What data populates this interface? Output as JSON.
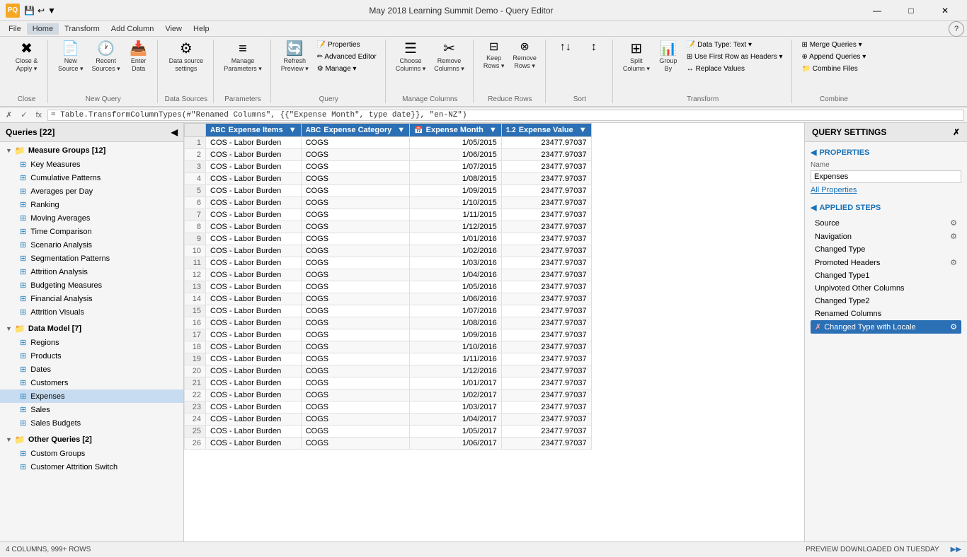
{
  "titleBar": {
    "appIcon": "PQ",
    "title": "May 2018 Learning Summit Demo - Query Editor",
    "quickActions": [
      "💾",
      "↩",
      "▼"
    ]
  },
  "menuBar": {
    "items": [
      "File",
      "Home",
      "Transform",
      "Add Column",
      "View",
      "Help"
    ]
  },
  "ribbonTabs": {
    "activeTab": "Home",
    "tabs": [
      "File",
      "Home",
      "Transform",
      "Add Column",
      "View",
      "Help"
    ]
  },
  "ribbonGroups": {
    "close": {
      "label": "Close",
      "buttons": [
        {
          "icon": "✖",
          "label": "Close &\nApply ▾"
        }
      ]
    },
    "newQuery": {
      "label": "New Query",
      "buttons": [
        {
          "icon": "📄",
          "label": "New\nSource ▾"
        },
        {
          "icon": "🕐",
          "label": "Recent\nSources ▾"
        },
        {
          "icon": "📥",
          "label": "Enter\nData"
        }
      ]
    },
    "dataSources": {
      "label": "Data Sources",
      "buttons": [
        {
          "icon": "⚙",
          "label": "Data source\nsettings"
        }
      ]
    },
    "parameters": {
      "label": "Parameters",
      "buttons": [
        {
          "icon": "≡",
          "label": "Manage\nParameters ▾"
        }
      ]
    },
    "query": {
      "label": "Query",
      "buttons": [
        {
          "icon": "🔄",
          "label": "Refresh\nPreview ▾"
        },
        {
          "icon": "📝",
          "label": "Properties"
        },
        {
          "icon": "✏",
          "label": "Advanced Editor"
        },
        {
          "icon": "⚙",
          "label": "Manage ▾"
        }
      ]
    },
    "manageColumns": {
      "label": "Manage Columns",
      "buttons": [
        {
          "icon": "☰",
          "label": "Choose\nColumns ▾"
        },
        {
          "icon": "✂",
          "label": "Remove\nColumns ▾"
        }
      ]
    },
    "reduceRows": {
      "label": "Reduce Rows",
      "buttons": [
        {
          "icon": "⊟",
          "label": "Keep\nRows ▾"
        },
        {
          "icon": "⊗",
          "label": "Remove\nRows ▾"
        }
      ]
    },
    "sort": {
      "label": "Sort",
      "buttons": [
        {
          "icon": "↑↓",
          "label": ""
        },
        {
          "icon": "↕",
          "label": ""
        }
      ]
    },
    "transform": {
      "label": "Transform",
      "smallButtons": [
        "Data Type: Text ▾",
        "Use First Row as Headers ▾",
        "Replace Values"
      ],
      "buttons": [
        {
          "icon": "⊞",
          "label": "Split\nColumn ▾"
        },
        {
          "icon": "📊",
          "label": "Group\nBy"
        }
      ]
    },
    "combine": {
      "label": "Combine",
      "smallButtons": [
        "Merge Queries ▾",
        "Append Queries ▾",
        "Combine Files"
      ]
    }
  },
  "formulaBar": {
    "checkmark": "✓",
    "cross": "✗",
    "fx": "fx",
    "formula": "= Table.TransformColumnTypes(#\"Renamed Columns\", {{\"Expense Month\", type date}}, \"en-NZ\")"
  },
  "sidebar": {
    "title": "Queries [22]",
    "groups": [
      {
        "name": "Measure Groups [12]",
        "expanded": true,
        "items": [
          "Key Measures",
          "Cumulative Patterns",
          "Averages per Day",
          "Ranking",
          "Moving Averages",
          "Time Comparison",
          "Scenario Analysis",
          "Segmentation Patterns",
          "Attrition Analysis",
          "Budgeting Measures",
          "Financial Analysis",
          "Attrition Visuals"
        ]
      },
      {
        "name": "Data Model [7]",
        "expanded": true,
        "items": [
          "Regions",
          "Products",
          "Dates",
          "Customers",
          "Expenses",
          "Sales",
          "Sales Budgets"
        ]
      },
      {
        "name": "Other Queries [2]",
        "expanded": true,
        "items": [
          "Custom Groups",
          "Customer Attrition Switch"
        ]
      }
    ],
    "activeItem": "Expenses"
  },
  "dataGrid": {
    "columns": [
      {
        "name": "Expense Items",
        "type": "ABC",
        "selected": true
      },
      {
        "name": "Expense Category",
        "type": "ABC",
        "selected": true
      },
      {
        "name": "Expense Month",
        "type": "📅",
        "selected": true
      },
      {
        "name": "Expense Value",
        "type": "1.2",
        "selected": true
      }
    ],
    "rows": [
      [
        "COS - Labor Burden",
        "COGS",
        "1/05/2015",
        "23477.97037"
      ],
      [
        "COS - Labor Burden",
        "COGS",
        "1/06/2015",
        "23477.97037"
      ],
      [
        "COS - Labor Burden",
        "COGS",
        "1/07/2015",
        "23477.97037"
      ],
      [
        "COS - Labor Burden",
        "COGS",
        "1/08/2015",
        "23477.97037"
      ],
      [
        "COS - Labor Burden",
        "COGS",
        "1/09/2015",
        "23477.97037"
      ],
      [
        "COS - Labor Burden",
        "COGS",
        "1/10/2015",
        "23477.97037"
      ],
      [
        "COS - Labor Burden",
        "COGS",
        "1/11/2015",
        "23477.97037"
      ],
      [
        "COS - Labor Burden",
        "COGS",
        "1/12/2015",
        "23477.97037"
      ],
      [
        "COS - Labor Burden",
        "COGS",
        "1/01/2016",
        "23477.97037"
      ],
      [
        "COS - Labor Burden",
        "COGS",
        "1/02/2016",
        "23477.97037"
      ],
      [
        "COS - Labor Burden",
        "COGS",
        "1/03/2016",
        "23477.97037"
      ],
      [
        "COS - Labor Burden",
        "COGS",
        "1/04/2016",
        "23477.97037"
      ],
      [
        "COS - Labor Burden",
        "COGS",
        "1/05/2016",
        "23477.97037"
      ],
      [
        "COS - Labor Burden",
        "COGS",
        "1/06/2016",
        "23477.97037"
      ],
      [
        "COS - Labor Burden",
        "COGS",
        "1/07/2016",
        "23477.97037"
      ],
      [
        "COS - Labor Burden",
        "COGS",
        "1/08/2016",
        "23477.97037"
      ],
      [
        "COS - Labor Burden",
        "COGS",
        "1/09/2016",
        "23477.97037"
      ],
      [
        "COS - Labor Burden",
        "COGS",
        "1/10/2016",
        "23477.97037"
      ],
      [
        "COS - Labor Burden",
        "COGS",
        "1/11/2016",
        "23477.97037"
      ],
      [
        "COS - Labor Burden",
        "COGS",
        "1/12/2016",
        "23477.97037"
      ],
      [
        "COS - Labor Burden",
        "COGS",
        "1/01/2017",
        "23477.97037"
      ],
      [
        "COS - Labor Burden",
        "COGS",
        "1/02/2017",
        "23477.97037"
      ],
      [
        "COS - Labor Burden",
        "COGS",
        "1/03/2017",
        "23477.97037"
      ],
      [
        "COS - Labor Burden",
        "COGS",
        "1/04/2017",
        "23477.97037"
      ],
      [
        "COS - Labor Burden",
        "COGS",
        "1/05/2017",
        "23477.97037"
      ],
      [
        "COS - Labor Burden",
        "COGS",
        "1/06/2017",
        "23477.97037"
      ]
    ]
  },
  "querySettings": {
    "title": "QUERY SETTINGS",
    "properties": {
      "title": "PROPERTIES",
      "nameLabel": "Name",
      "nameValue": "Expenses",
      "allPropertiesLink": "All Properties"
    },
    "appliedSteps": {
      "title": "APPLIED STEPS",
      "steps": [
        {
          "name": "Source",
          "hasSettings": true,
          "hasError": false,
          "active": false
        },
        {
          "name": "Navigation",
          "hasSettings": true,
          "hasError": false,
          "active": false
        },
        {
          "name": "Changed Type",
          "hasSettings": false,
          "hasError": false,
          "active": false
        },
        {
          "name": "Promoted Headers",
          "hasSettings": true,
          "hasError": false,
          "active": false
        },
        {
          "name": "Changed Type1",
          "hasSettings": false,
          "hasError": false,
          "active": false
        },
        {
          "name": "Unpivoted Other Columns",
          "hasSettings": false,
          "hasError": false,
          "active": false
        },
        {
          "name": "Changed Type2",
          "hasSettings": false,
          "hasError": false,
          "active": false
        },
        {
          "name": "Renamed Columns",
          "hasSettings": false,
          "hasError": false,
          "active": false
        },
        {
          "name": "Changed Type with Locale",
          "hasSettings": true,
          "hasError": true,
          "active": true
        }
      ]
    }
  },
  "statusBar": {
    "rowCount": "4 COLUMNS, 999+ ROWS",
    "preview": "PREVIEW DOWNLOADED ON TUESDAY"
  }
}
